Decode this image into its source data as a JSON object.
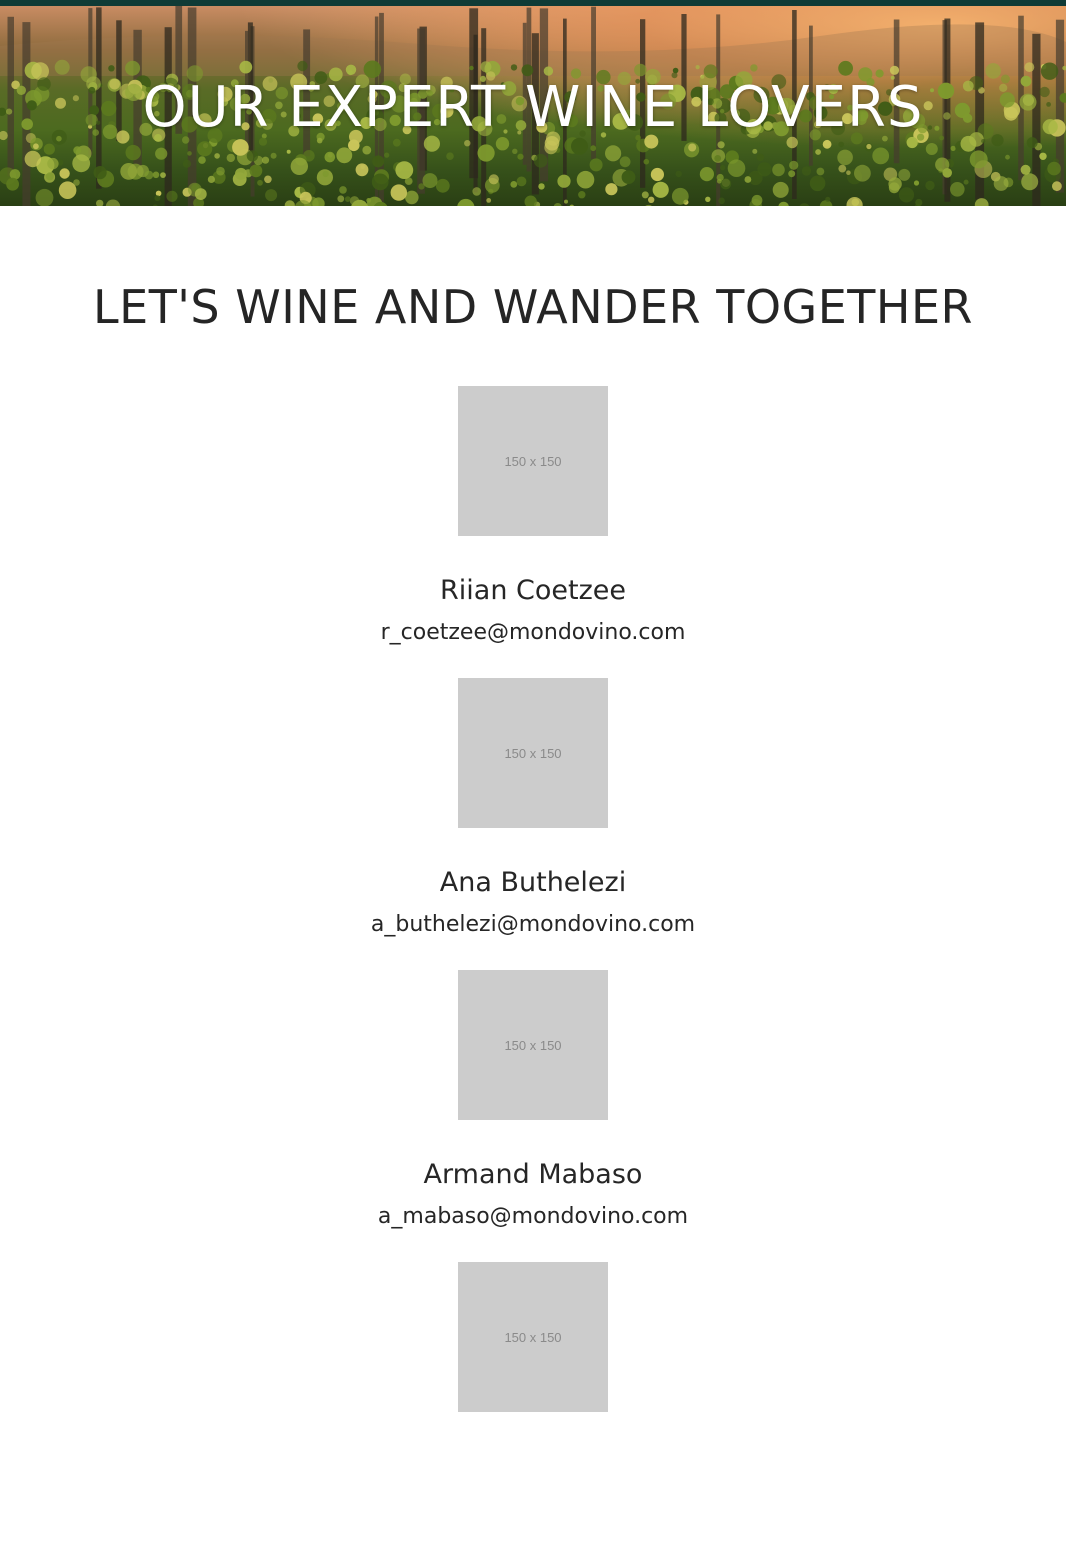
{
  "hero": {
    "title": "OUR EXPERT WINE LOVERS"
  },
  "section": {
    "heading": "LET'S WINE AND WANDER TOGETHER"
  },
  "team": [
    {
      "photo_label": "150 x 150",
      "name": "Riian Coetzee",
      "email": "r_coetzee@mondovino.com"
    },
    {
      "photo_label": "150 x 150",
      "name": "Ana Buthelezi",
      "email": "a_buthelezi@mondovino.com"
    },
    {
      "photo_label": "150 x 150",
      "name": "Armand Mabaso",
      "email": "a_mabaso@mondovino.com"
    },
    {
      "photo_label": "150 x 150"
    }
  ],
  "colors": {
    "top_rule": "#0f3b36",
    "photo_placeholder": "#cccccc",
    "text": "#262626"
  }
}
